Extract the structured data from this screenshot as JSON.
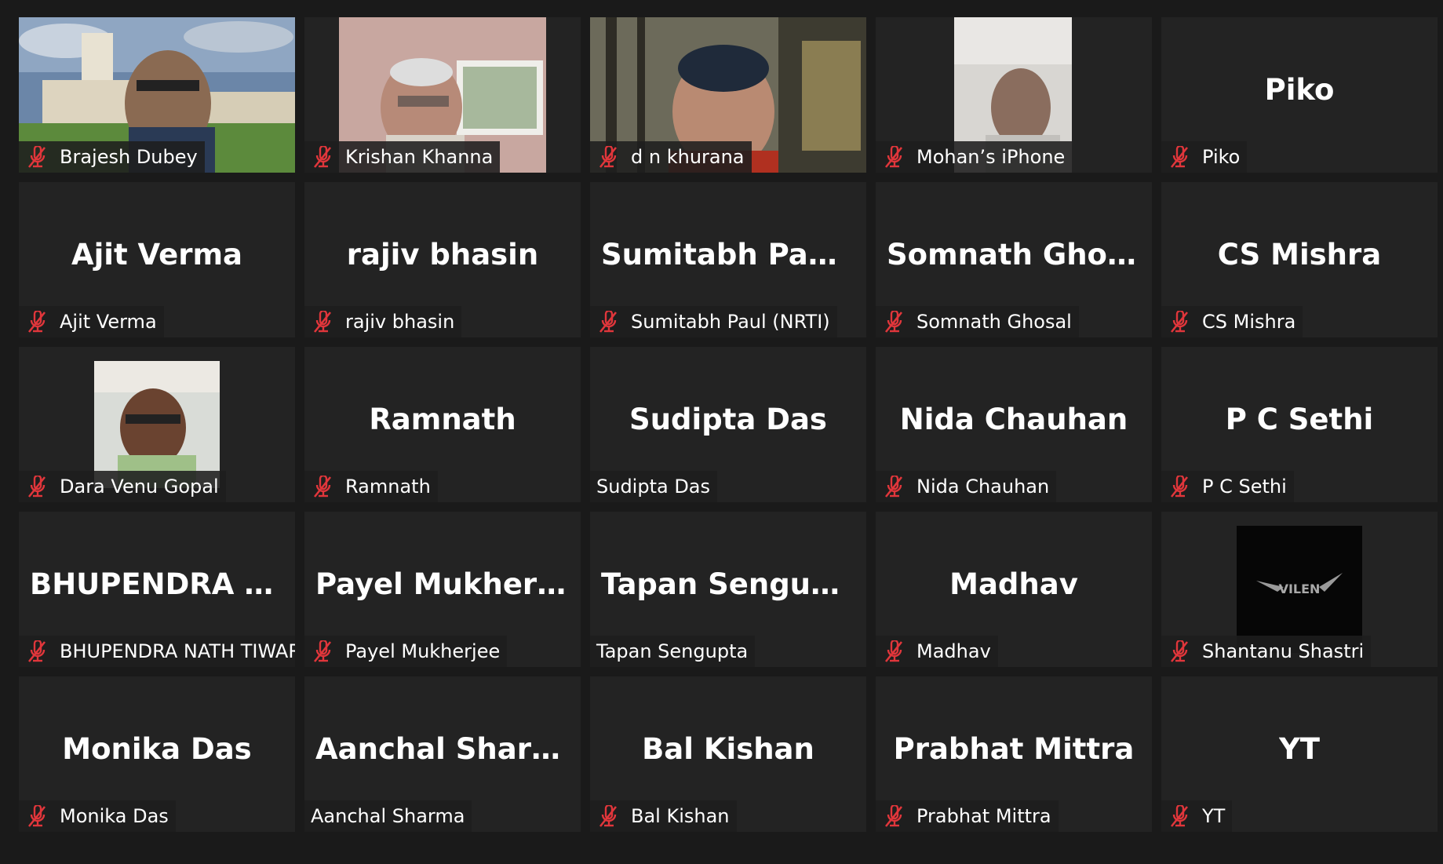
{
  "colors": {
    "background": "#1a1a1a",
    "tile": "#232323",
    "label_bg": "#1e1e1e",
    "mute_icon": "#e0363b",
    "text": "#ffffff"
  },
  "participants": [
    {
      "display": "",
      "label": "Brajesh Dubey",
      "muted": true,
      "video": true
    },
    {
      "display": "",
      "label": "Krishan Khanna",
      "muted": true,
      "video": true
    },
    {
      "display": "",
      "label": "d n khurana",
      "muted": true,
      "video": true
    },
    {
      "display": "",
      "label": "Mohan’s iPhone",
      "muted": true,
      "video": true
    },
    {
      "display": "Piko",
      "label": "Piko",
      "muted": true,
      "video": false
    },
    {
      "display": "Ajit Verma",
      "label": "Ajit Verma",
      "muted": true,
      "video": false
    },
    {
      "display": "rajiv bhasin",
      "label": "rajiv bhasin",
      "muted": true,
      "video": false
    },
    {
      "display": "Sumitabh  Paul  (...",
      "label": "Sumitabh Paul (NRTI)",
      "muted": true,
      "video": false
    },
    {
      "display": "Somnath Ghosal",
      "label": "Somnath Ghosal",
      "muted": true,
      "video": false
    },
    {
      "display": "CS Mishra",
      "label": "CS Mishra",
      "muted": true,
      "video": false
    },
    {
      "display": "",
      "label": "Dara Venu Gopal",
      "muted": true,
      "video": false,
      "avatar": true
    },
    {
      "display": "Ramnath",
      "label": "Ramnath",
      "muted": true,
      "video": false
    },
    {
      "display": "Sudipta Das",
      "label": "Sudipta Das",
      "muted": false,
      "video": false
    },
    {
      "display": "Nida Chauhan",
      "label": "Nida Chauhan",
      "muted": true,
      "video": false
    },
    {
      "display": "P C Sethi",
      "label": "P C Sethi",
      "muted": true,
      "video": false
    },
    {
      "display": "BHUPENDRA  N...",
      "label": "BHUPENDRA NATH TIWARY",
      "muted": true,
      "video": false
    },
    {
      "display": "Payel Mukherjee",
      "label": "Payel Mukherjee",
      "muted": true,
      "video": false
    },
    {
      "display": "Tapan Sengupta",
      "label": "Tapan Sengupta",
      "muted": false,
      "video": false
    },
    {
      "display": "Madhav",
      "label": "Madhav",
      "muted": true,
      "video": false
    },
    {
      "display": "",
      "label": "Shantanu Shastri",
      "muted": true,
      "video": false,
      "avatar": true,
      "avatar_logo": "VILEN"
    },
    {
      "display": "Monika Das",
      "label": "Monika Das",
      "muted": true,
      "video": false
    },
    {
      "display": "Aanchal Sharma",
      "label": "Aanchal Sharma",
      "muted": false,
      "video": false
    },
    {
      "display": "Bal Kishan",
      "label": "Bal Kishan",
      "muted": true,
      "video": false
    },
    {
      "display": "Prabhat Mittra",
      "label": "Prabhat Mittra",
      "muted": true,
      "video": false
    },
    {
      "display": "YT",
      "label": "YT",
      "muted": true,
      "video": false
    }
  ]
}
